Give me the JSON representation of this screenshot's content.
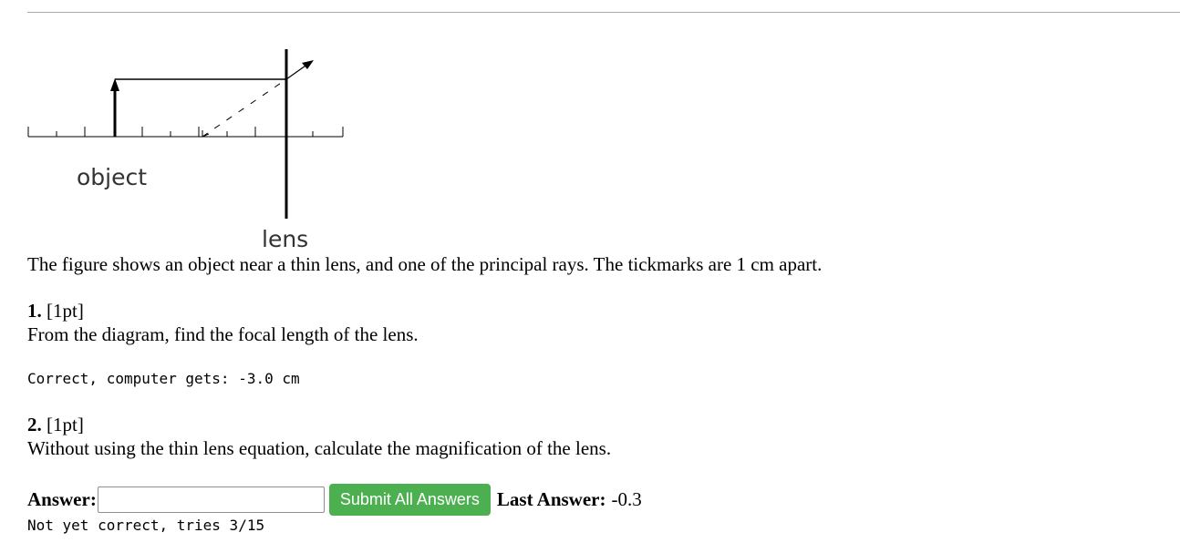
{
  "figure": {
    "object_label": "object",
    "lens_label": "lens"
  },
  "intro": "The figure shows an object near a thin lens, and one of the principal rays. The tickmarks are 1 cm apart.",
  "questions": [
    {
      "number": "1.",
      "points": "[1pt]",
      "prompt": "From the diagram, find the focal length of the lens.",
      "feedback": "Correct, computer gets: -3.0 cm"
    },
    {
      "number": "2.",
      "points": "[1pt]",
      "prompt": "Without using the thin lens equation, calculate the magnification of the lens.",
      "answer_label": "Answer:",
      "answer_value": "",
      "submit_label": "Submit All Answers",
      "last_answer_label": "Last Answer:",
      "last_answer_value": "-0.3",
      "feedback": "Not yet correct, tries 3/15"
    }
  ],
  "colors": {
    "submit_button": "#4caf50",
    "rule": "#a8a8a8"
  }
}
